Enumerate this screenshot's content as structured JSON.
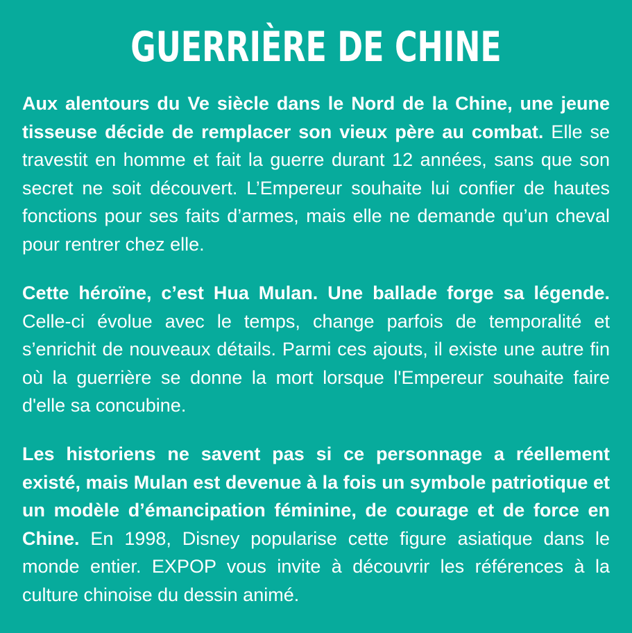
{
  "title": "GUERRIÈRE DE CHINE",
  "paragraphs": [
    {
      "bold": "Aux alentours du Ve siècle dans le Nord de la Chine, une jeune tisseuse décide de remplacer son vieux père au combat.",
      "regular": " Elle se travestit en homme et fait la guerre durant 12 années, sans que son secret ne soit découvert. L’Empereur souhaite lui confier de hautes fonctions pour ses faits d’armes, mais elle ne demande qu’un cheval pour rentrer chez elle."
    },
    {
      "bold": "Cette héroïne, c’est Hua Mulan. Une ballade forge sa légende.",
      "regular": " Celle-ci évolue avec le temps, change parfois de temporalité et s’enrichit de nouveaux détails. Parmi ces ajouts, il existe une autre fin où la guerrière se donne la mort lorsque l'Empereur souhaite faire d'elle sa concubine."
    },
    {
      "bold": "Les historiens ne savent pas si ce personnage a réellement existé, mais Mulan est devenue à la fois un symbole patriotique et un modèle d’émancipation féminine, de courage et de force en Chine.",
      "regular": " En 1998, Disney popularise cette figure asiatique dans le monde entier. EXPOP vous invite à découvrir les références à la culture chinoise du dessin animé."
    }
  ],
  "colors": {
    "background": "#07ab9c",
    "text": "#ffffff"
  }
}
